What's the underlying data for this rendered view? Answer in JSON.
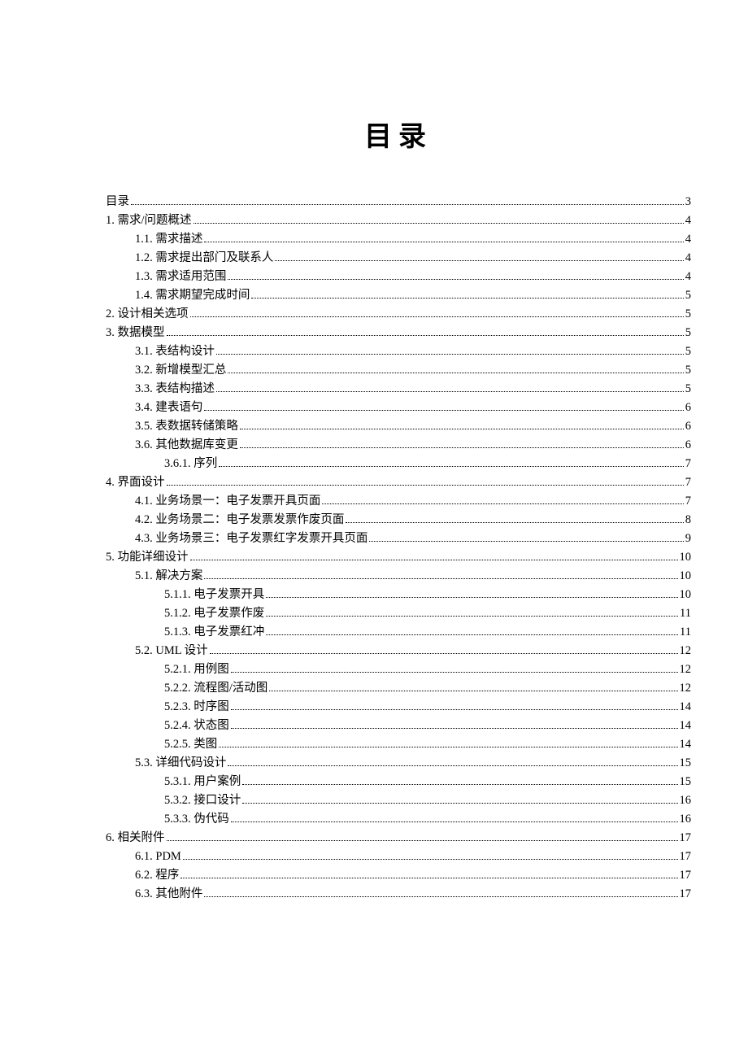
{
  "title": "目录",
  "entries": [
    {
      "label": "目录",
      "page": "3",
      "level": 0
    },
    {
      "label": "1. 需求/问题概述",
      "page": "4",
      "level": 0
    },
    {
      "label": "1.1. 需求描述",
      "page": "4",
      "level": 1
    },
    {
      "label": "1.2. 需求提出部门及联系人",
      "page": "4",
      "level": 1
    },
    {
      "label": "1.3. 需求适用范围",
      "page": "4",
      "level": 1
    },
    {
      "label": "1.4. 需求期望完成时间",
      "page": "5",
      "level": 1
    },
    {
      "label": "2. 设计相关选项",
      "page": "5",
      "level": 0
    },
    {
      "label": "3. 数据模型",
      "page": "5",
      "level": 0
    },
    {
      "label": "3.1. 表结构设计",
      "page": "5",
      "level": 1
    },
    {
      "label": "3.2. 新增模型汇总",
      "page": "5",
      "level": 1
    },
    {
      "label": "3.3. 表结构描述",
      "page": "5",
      "level": 1
    },
    {
      "label": "3.4. 建表语句",
      "page": "6",
      "level": 1
    },
    {
      "label": "3.5. 表数据转储策略",
      "page": "6",
      "level": 1
    },
    {
      "label": "3.6. 其他数据库变更",
      "page": "6",
      "level": 1
    },
    {
      "label": "3.6.1. 序列",
      "page": "7",
      "level": 2
    },
    {
      "label": "4. 界面设计",
      "page": "7",
      "level": 0
    },
    {
      "label": "4.1. 业务场景一：电子发票开具页面",
      "page": "7",
      "level": 1
    },
    {
      "label": "4.2. 业务场景二：电子发票发票作废页面",
      "page": "8",
      "level": 1
    },
    {
      "label": "4.3. 业务场景三：电子发票红字发票开具页面",
      "page": "9",
      "level": 1
    },
    {
      "label": "5. 功能详细设计",
      "page": "10",
      "level": 0
    },
    {
      "label": "5.1. 解决方案",
      "page": "10",
      "level": 1
    },
    {
      "label": "5.1.1. 电子发票开具",
      "page": "10",
      "level": 2
    },
    {
      "label": "5.1.2. 电子发票作废",
      "page": "11",
      "level": 2
    },
    {
      "label": "5.1.3. 电子发票红冲",
      "page": "11",
      "level": 2
    },
    {
      "label": "5.2. UML 设计",
      "page": "12",
      "level": 1
    },
    {
      "label": "5.2.1. 用例图",
      "page": "12",
      "level": 2
    },
    {
      "label": "5.2.2. 流程图/活动图",
      "page": "12",
      "level": 2
    },
    {
      "label": "5.2.3. 时序图",
      "page": "14",
      "level": 2
    },
    {
      "label": "5.2.4. 状态图",
      "page": "14",
      "level": 2
    },
    {
      "label": "5.2.5. 类图",
      "page": "14",
      "level": 2
    },
    {
      "label": "5.3. 详细代码设计",
      "page": "15",
      "level": 1
    },
    {
      "label": "5.3.1. 用户案例",
      "page": "15",
      "level": 2
    },
    {
      "label": "5.3.2. 接口设计",
      "page": "16",
      "level": 2
    },
    {
      "label": "5.3.3. 伪代码",
      "page": "16",
      "level": 2
    },
    {
      "label": "6. 相关附件",
      "page": "17",
      "level": 0
    },
    {
      "label": "6.1. PDM",
      "page": "17",
      "level": 1
    },
    {
      "label": "6.2. 程序",
      "page": "17",
      "level": 1
    },
    {
      "label": "6.3. 其他附件",
      "page": "17",
      "level": 1
    }
  ]
}
